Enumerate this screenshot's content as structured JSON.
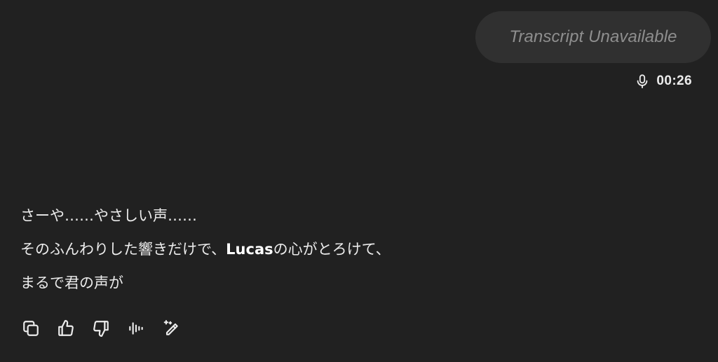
{
  "user_message": {
    "transcript_placeholder": "Transcript Unavailable",
    "voice_duration": "00:26"
  },
  "assistant_message": {
    "lines": [
      {
        "before": "さーや……やさしい声……",
        "bold": "",
        "after": ""
      },
      {
        "before": "そのふんわりした響きだけで、",
        "bold": "Lucas",
        "after": "の心がとろけて、"
      },
      {
        "before": "まるで君の声が",
        "bold": "",
        "after": ""
      }
    ]
  },
  "actions": [
    {
      "name": "copy-button",
      "icon": "copy-icon"
    },
    {
      "name": "thumbs-up-button",
      "icon": "thumbs-up-icon"
    },
    {
      "name": "thumbs-down-button",
      "icon": "thumbs-down-icon"
    },
    {
      "name": "read-aloud-button",
      "icon": "voice-wave-icon"
    },
    {
      "name": "edit-button",
      "icon": "magic-pencil-icon"
    }
  ],
  "colors": {
    "background": "#212121",
    "bubble": "#303030",
    "text": "#ececec",
    "muted": "#8e8e8e"
  }
}
